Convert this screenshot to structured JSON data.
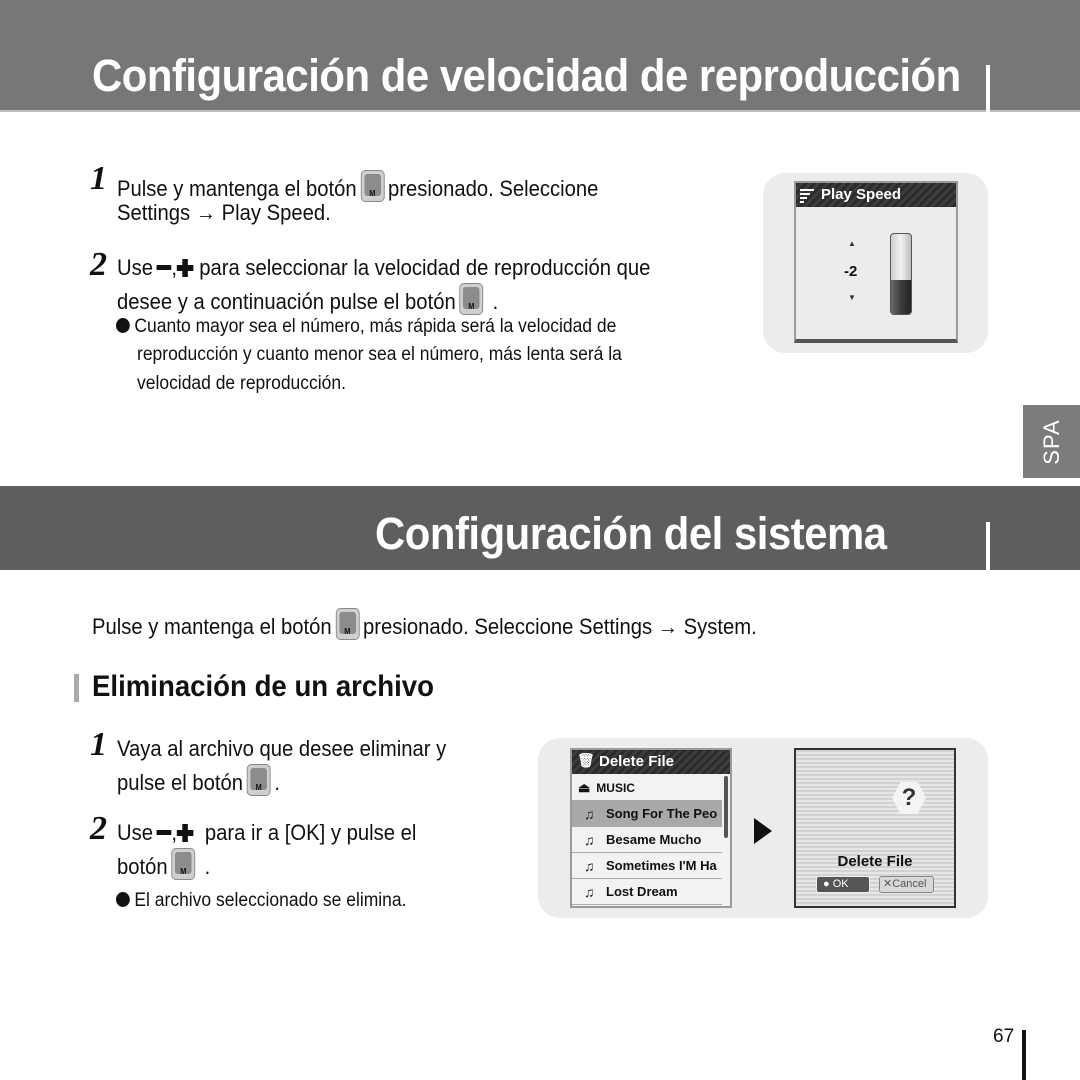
{
  "section1": {
    "title": "Configuración de velocidad de reproducción",
    "steps": [
      {
        "number": "1",
        "line1_a": "Pulse y mantenga el botón",
        "line1_b": "presionado. Seleccione",
        "line2": "Settings → Play Speed."
      },
      {
        "number": "2",
        "line1_a": "Use",
        "line1_sep": ",",
        "line1_b": "para seleccionar la velocidad de reproducción que",
        "line2": "desee y a continuación pulse el botón",
        "line2_end": "."
      }
    ],
    "note_lines": [
      "Cuanto mayor sea el número, más rápida será la velocidad de",
      "reproducción y cuanto menor sea el número, más lenta será la",
      "velocidad de reproducción."
    ],
    "screen": {
      "header": "Play Speed",
      "value": "-2",
      "level_fraction": 0.42,
      "up_arrow": "▲",
      "down_arrow": "▼"
    }
  },
  "side_tab": "SPA",
  "section2": {
    "title": "Configuración del sistema",
    "intro_a": "Pulse y mantenga el botón",
    "intro_b": "presionado. Seleccione Settings → System.",
    "subheading": "Eliminación de un archivo",
    "steps": [
      {
        "number": "1",
        "line1": "Vaya al archivo que desee eliminar y",
        "line2": "pulse el botón",
        "line2_end": "."
      },
      {
        "number": "2",
        "line1_a": "Use",
        "line1_sep": ",",
        "line1_b": "para ir a [OK] y pulse el",
        "line2": "botón",
        "line2_end": "."
      }
    ],
    "note": "El archivo seleccionado se elimina.",
    "screen_list": {
      "header": "Delete File",
      "folder": "MUSIC",
      "items": [
        "Song For The Peo",
        "Besame Mucho",
        "Sometimes I'M Ha",
        "Lost Dream"
      ],
      "selected_index": 0
    },
    "screen_dialog": {
      "title": "Delete File",
      "ok": "OK",
      "cancel": "Cancel"
    }
  },
  "button_glyph": "M",
  "page_number": "67"
}
